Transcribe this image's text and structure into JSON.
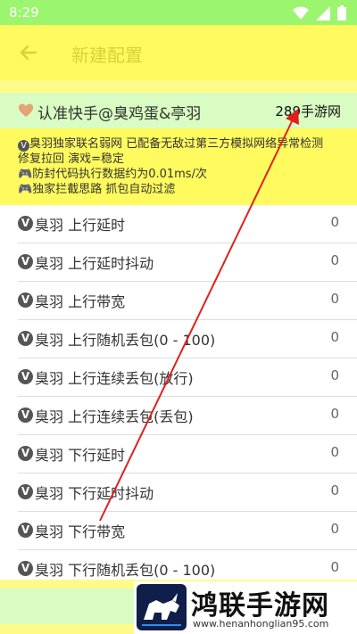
{
  "status_bar": {
    "time": "8:29"
  },
  "toolbar": {
    "title": "新建配置"
  },
  "brand_row": {
    "label": "认准快手@臭鸡蛋&亭羽",
    "tag": "289手游网"
  },
  "info": {
    "line1": "臭羽独家联名弱网 已配备无敌过第三方模拟网络异常检测",
    "line2": "修复拉回 演戏=稳定",
    "line3": "防封代码执行数据约为0.01ms/次",
    "line4": "独家拦截思路 抓包自动过滤"
  },
  "settings": [
    {
      "label": "臭羽 上行延时",
      "value": "0"
    },
    {
      "label": "臭羽 上行延时抖动",
      "value": "0"
    },
    {
      "label": "臭羽 上行带宽",
      "value": "0"
    },
    {
      "label": "臭羽 上行随机丢包(0 - 100)",
      "value": "0"
    },
    {
      "label": "臭羽 上行连续丢包(放行)",
      "value": "0"
    },
    {
      "label": "臭羽 上行连续丢包(丢包)",
      "value": "0"
    },
    {
      "label": "臭羽 下行延时",
      "value": "0"
    },
    {
      "label": "臭羽 下行延时抖动",
      "value": "0"
    },
    {
      "label": "臭羽 下行带宽",
      "value": "0"
    },
    {
      "label": "臭羽 下行随机丢包(0 - 100)",
      "value": "0"
    }
  ],
  "watermark": {
    "title": "鸿联手游网",
    "url": "www.henanhonglian95.com"
  },
  "colors": {
    "status_bar": "#9cf56e",
    "toolbar": "#fffb5e",
    "brand_row": "#d9fcc2",
    "arrow": "#e0201f"
  }
}
